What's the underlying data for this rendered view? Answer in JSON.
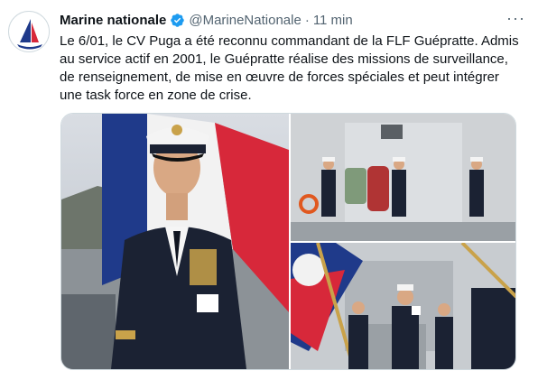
{
  "account": {
    "name": "Marine nationale",
    "handle": "@MarineNationale",
    "separator": "·",
    "time": "11 min",
    "verified": true,
    "avatar_icon": "marine-nationale-logo-icon"
  },
  "more_icon": "more-options-icon",
  "more_label": "···",
  "tweet": {
    "text_lines": [
      "Le 6/01, le CV Puga a été reconnu commandant de la FLF Guépratte. Admis",
      "au service actif en 2001, le Guépratte réalise des missions de surveillance,",
      "de renseignement, de mise en œuvre de forces spéciales et peut intégrer",
      "une task force en zone de crise."
    ]
  },
  "colors": {
    "text": "#0f1419",
    "secondary": "#536471",
    "verified_blue": "#1d9bf0",
    "navy_uniform": "#1b2233",
    "flag_red": "#d7283a",
    "flag_blue": "#1f3a8a"
  }
}
